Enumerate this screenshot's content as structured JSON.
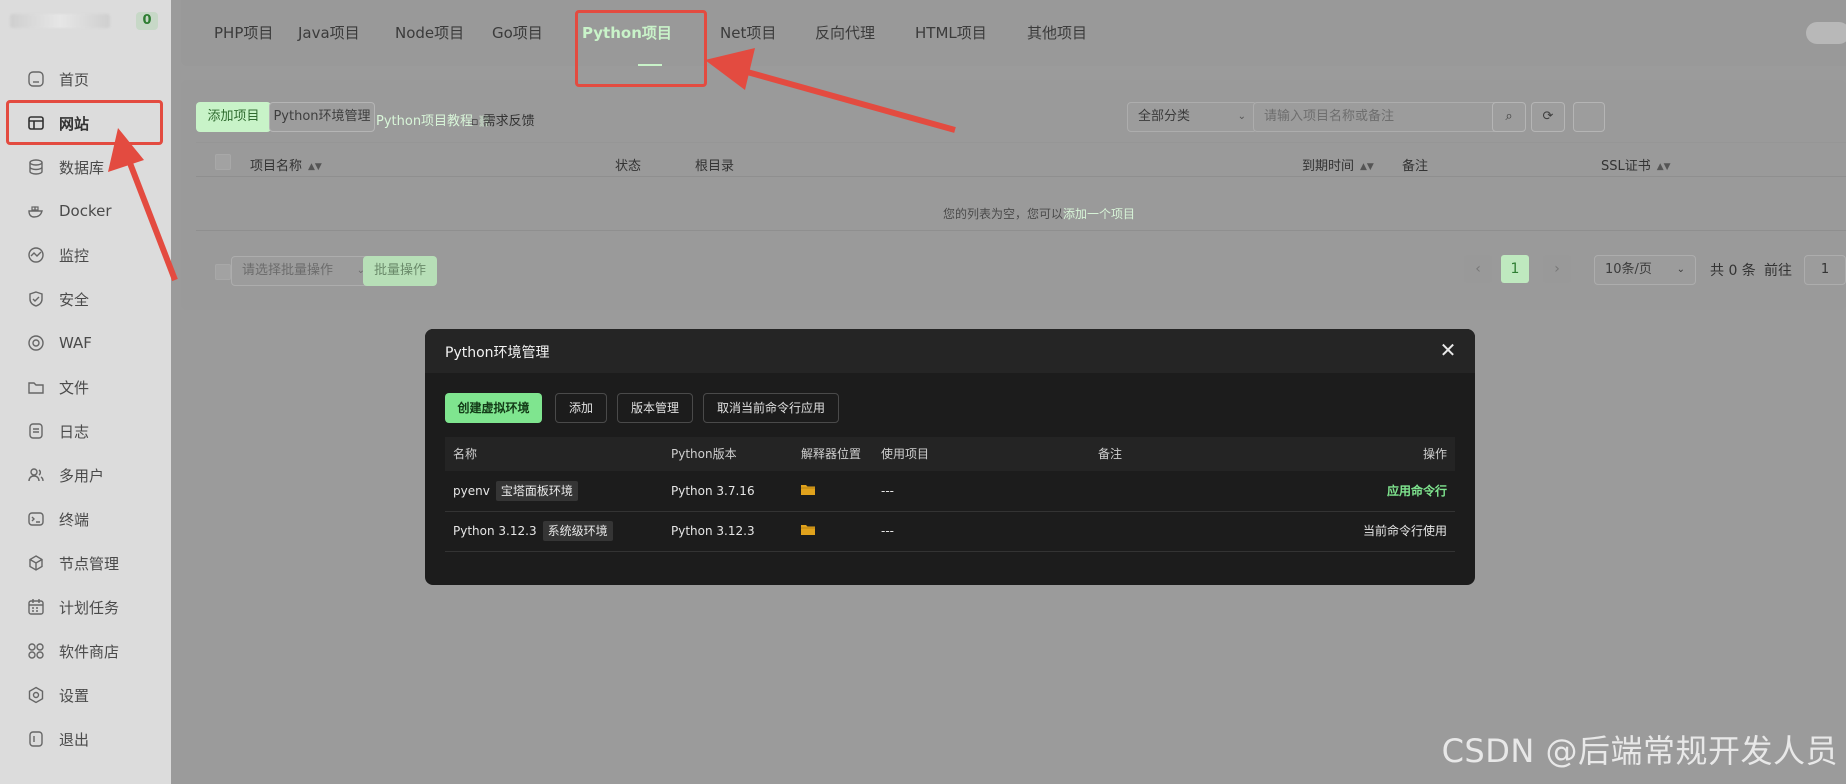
{
  "sidebar": {
    "badge": "0",
    "items": [
      {
        "label": "首页",
        "icon": "home-icon"
      },
      {
        "label": "网站",
        "icon": "website-icon"
      },
      {
        "label": "数据库",
        "icon": "database-icon"
      },
      {
        "label": "Docker",
        "icon": "docker-icon"
      },
      {
        "label": "监控",
        "icon": "monitor-icon"
      },
      {
        "label": "安全",
        "icon": "shield-icon"
      },
      {
        "label": "WAF",
        "icon": "waf-icon"
      },
      {
        "label": "文件",
        "icon": "folder-icon"
      },
      {
        "label": "日志",
        "icon": "log-icon"
      },
      {
        "label": "多用户",
        "icon": "users-icon"
      },
      {
        "label": "终端",
        "icon": "terminal-icon"
      },
      {
        "label": "节点管理",
        "icon": "node-icon"
      },
      {
        "label": "计划任务",
        "icon": "calendar-icon"
      },
      {
        "label": "软件商店",
        "icon": "store-icon"
      },
      {
        "label": "设置",
        "icon": "settings-icon"
      },
      {
        "label": "退出",
        "icon": "logout-icon"
      }
    ]
  },
  "tabs": [
    "PHP项目",
    "Java项目",
    "Node项目",
    "Go项目",
    "Python项目",
    "Net项目",
    "反向代理",
    "HTML项目",
    "其他项目"
  ],
  "toolbar": {
    "add_project": "添加项目",
    "python_env": "Python环境管理",
    "tutorial": "Python项目教程",
    "feedback": "需求反馈",
    "category": "全部分类",
    "search_placeholder": "请输入项目名称或备注"
  },
  "table": {
    "headers": {
      "name": "项目名称",
      "status": "状态",
      "root": "根目录",
      "expire": "到期时间",
      "note": "备注",
      "ssl": "SSL证书"
    },
    "empty_prefix": "您的列表为空，您可以",
    "empty_link": "添加一个项目"
  },
  "footer": {
    "batch_placeholder": "请选择批量操作",
    "batch_button": "批量操作",
    "page": "1",
    "page_size": "10条/页",
    "total": "共 0 条",
    "goto": "前往",
    "goto_value": "1"
  },
  "modal": {
    "title": "Python环境管理",
    "buttons": {
      "create_venv": "创建虚拟环境",
      "add": "添加",
      "version_mgmt": "版本管理",
      "cancel_cli": "取消当前命令行应用"
    },
    "headers": {
      "name": "名称",
      "version": "Python版本",
      "location": "解释器位置",
      "projects": "使用项目",
      "note": "备注",
      "action": "操作"
    },
    "rows": [
      {
        "name": "pyenv",
        "tag": "宝塔面板环境",
        "version": "Python 3.7.16",
        "projects": "---",
        "action": "应用命令行"
      },
      {
        "name": "Python 3.12.3",
        "tag": "系统级环境",
        "version": "Python 3.12.3",
        "projects": "---",
        "action": "当前命令行使用"
      }
    ]
  },
  "watermark": "CSDN @后端常规开发人员",
  "colors": {
    "accent_green": "#7fe58f",
    "highlight_red": "#e34b40"
  }
}
